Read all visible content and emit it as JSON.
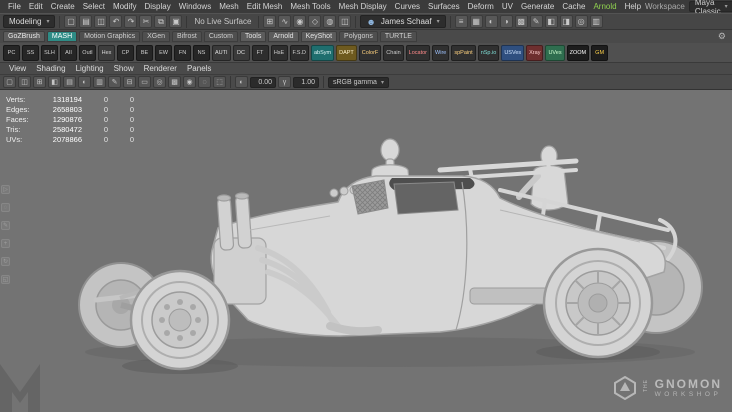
{
  "menubar": {
    "items": [
      {
        "label": "File",
        "color": "#d6d6d6"
      },
      {
        "label": "Edit",
        "color": "#d6d6d6"
      },
      {
        "label": "Create",
        "color": "#d6d6d6"
      },
      {
        "label": "Select",
        "color": "#d6d6d6"
      },
      {
        "label": "Modify",
        "color": "#d6d6d6"
      },
      {
        "label": "Display",
        "color": "#d6d6d6"
      },
      {
        "label": "Windows",
        "color": "#d6d6d6"
      },
      {
        "label": "Mesh",
        "color": "#d6d6d6"
      },
      {
        "label": "Edit Mesh",
        "color": "#d6d6d6"
      },
      {
        "label": "Mesh Tools",
        "color": "#d6d6d6"
      },
      {
        "label": "Mesh Display",
        "color": "#d6d6d6"
      },
      {
        "label": "Curves",
        "color": "#d6d6d6"
      },
      {
        "label": "Surfaces",
        "color": "#d6d6d6"
      },
      {
        "label": "Deform",
        "color": "#d6d6d6"
      },
      {
        "label": "UV",
        "color": "#d6d6d6"
      },
      {
        "label": "Generate",
        "color": "#d6d6d6"
      },
      {
        "label": "Cache",
        "color": "#d6d6d6"
      },
      {
        "label": "Arnold",
        "color": "#8fd14f"
      },
      {
        "label": "Help",
        "color": "#d6d6d6"
      }
    ],
    "workspace_label": "Workspace",
    "workspace_value": "Maya Classic"
  },
  "statusbar": {
    "mode": "Modeling",
    "live_surface": "No Live Surface",
    "user": "James Schaaf",
    "left_icons": [
      {
        "name": "new-scene-icon",
        "glyph": "▢"
      },
      {
        "name": "open-scene-icon",
        "glyph": "▤"
      },
      {
        "name": "save-scene-icon",
        "glyph": "◫"
      },
      {
        "name": "undo-icon",
        "glyph": "↶"
      },
      {
        "name": "redo-icon",
        "glyph": "↷"
      },
      {
        "name": "cut-icon",
        "glyph": "✂"
      },
      {
        "name": "copy-icon",
        "glyph": "⧉"
      },
      {
        "name": "paste-icon",
        "glyph": "▣"
      }
    ],
    "snap_icons": [
      {
        "name": "snap-grid-icon",
        "glyph": "⊞"
      },
      {
        "name": "snap-curve-icon",
        "glyph": "∿"
      },
      {
        "name": "snap-point-icon",
        "glyph": "◉"
      },
      {
        "name": "snap-plane-icon",
        "glyph": "◇"
      },
      {
        "name": "make-live-icon",
        "glyph": "◍"
      },
      {
        "name": "symmetry-icon",
        "glyph": "◫"
      }
    ],
    "right_icons": [
      {
        "name": "history-icon",
        "glyph": "≡"
      },
      {
        "name": "construction-icon",
        "glyph": "▦"
      },
      {
        "name": "render-icon",
        "glyph": "◐"
      },
      {
        "name": "ipr-render-icon",
        "glyph": "◑"
      },
      {
        "name": "render-settings-icon",
        "glyph": "▩"
      },
      {
        "name": "paint-effects-icon",
        "glyph": "✎"
      },
      {
        "name": "hypershade-icon",
        "glyph": "◧"
      },
      {
        "name": "toon-icon",
        "glyph": "◨"
      },
      {
        "name": "light-editor-icon",
        "glyph": "◎"
      },
      {
        "name": "displays-icon",
        "glyph": "▥"
      }
    ]
  },
  "shelf": {
    "tabs": [
      {
        "label": "GoZBrush",
        "bg": "#5c5c5c",
        "fg": "#e8e8e8"
      },
      {
        "label": "MASH",
        "bg": "#2e8c86",
        "fg": "#ffffff"
      },
      {
        "label": "Motion Graphics",
        "bg": "#4f4f4f",
        "fg": "#cfcfcf"
      },
      {
        "label": "XGen",
        "bg": "#4f4f4f",
        "fg": "#cfcfcf"
      },
      {
        "label": "Bifrost",
        "bg": "#4f4f4f",
        "fg": "#cfcfcf"
      },
      {
        "label": "Custom",
        "bg": "#4f4f4f",
        "fg": "#cfcfcf"
      },
      {
        "label": "Tools",
        "bg": "#5c5c5c",
        "fg": "#e2e2e2"
      },
      {
        "label": "Arnold",
        "bg": "#5c5c5c",
        "fg": "#e2e2e2"
      },
      {
        "label": "KeyShot",
        "bg": "#5c5c5c",
        "fg": "#e2e2e2"
      },
      {
        "label": "Polygons",
        "bg": "#4f4f4f",
        "fg": "#cfcfcf"
      },
      {
        "label": "TURTLE",
        "bg": "#4f4f4f",
        "fg": "#cfcfcf"
      }
    ],
    "items": [
      {
        "label": "PC",
        "bg": "#262626",
        "fg": "#cfcfcf"
      },
      {
        "label": "SS",
        "bg": "#262626",
        "fg": "#cfcfcf"
      },
      {
        "label": "SLH",
        "bg": "#262626",
        "fg": "#cfcfcf"
      },
      {
        "label": "AII",
        "bg": "#262626",
        "fg": "#cfcfcf"
      },
      {
        "label": "OutI",
        "bg": "#262626",
        "fg": "#cfcfcf"
      },
      {
        "label": "Hex",
        "bg": "#3d3d3d",
        "fg": "#d8d8d8"
      },
      {
        "label": "CP",
        "bg": "#262626",
        "fg": "#cfcfcf"
      },
      {
        "label": "BE",
        "bg": "#262626",
        "fg": "#cfcfcf"
      },
      {
        "label": "EW",
        "bg": "#262626",
        "fg": "#cfcfcf"
      },
      {
        "label": "FN",
        "bg": "#262626",
        "fg": "#cfcfcf"
      },
      {
        "label": "NS",
        "bg": "#262626",
        "fg": "#cfcfcf"
      },
      {
        "label": "AUTI",
        "bg": "#3a3a3a",
        "fg": "#e0e0e0"
      },
      {
        "label": "DC",
        "bg": "#3a3a3a",
        "fg": "#e0e0e0"
      },
      {
        "label": "FT",
        "bg": "#2e2e2e",
        "fg": "#cfcfcf"
      },
      {
        "label": "HsE",
        "bg": "#2e2e2e",
        "fg": "#cfcfcf"
      },
      {
        "label": "F.S.D",
        "bg": "#2e2e2e",
        "fg": "#cfcfcf"
      },
      {
        "label": "abSym",
        "bg": "#1f6e6e",
        "fg": "#dff5f5"
      },
      {
        "label": "DAPT",
        "bg": "#6e5a1f",
        "fg": "#fff3cf"
      },
      {
        "label": "ColorF",
        "bg": "#303030",
        "fg": "#ffd27f"
      },
      {
        "label": "Chain",
        "bg": "#303030",
        "fg": "#cfcfcf"
      },
      {
        "label": "Locator",
        "bg": "#303030",
        "fg": "#ff8a8a"
      },
      {
        "label": "Wire",
        "bg": "#303030",
        "fg": "#9fc3ff"
      },
      {
        "label": "spPaint",
        "bg": "#303030",
        "fg": "#ffd27f"
      },
      {
        "label": "nSp.io",
        "bg": "#303030",
        "fg": "#7fe0d8"
      },
      {
        "label": "USVes",
        "bg": "#2f4f7f",
        "fg": "#cfe4ff"
      },
      {
        "label": "Xray",
        "bg": "#6e2f2f",
        "fg": "#ffd0d0"
      },
      {
        "label": "UVes",
        "bg": "#2f6e4f",
        "fg": "#d0ffd0"
      },
      {
        "label": "ZOOM",
        "bg": "#1d1d1d",
        "fg": "#ffffff"
      },
      {
        "label": "GM",
        "bg": "#1d1d1d",
        "fg": "#ffd24a"
      }
    ]
  },
  "panel": {
    "menus": [
      "View",
      "Shading",
      "Lighting",
      "Show",
      "Renderer",
      "Panels"
    ],
    "toolbar_icons": [
      {
        "name": "select-camera-icon",
        "glyph": "▢"
      },
      {
        "name": "lock-camera-icon",
        "glyph": "◫"
      },
      {
        "name": "camera-attrs-icon",
        "glyph": "⊞"
      },
      {
        "name": "bookmark-icon",
        "glyph": "◧"
      },
      {
        "name": "image-plane-icon",
        "glyph": "▤"
      },
      {
        "name": "2d-pan-zoom-icon",
        "glyph": "◐"
      },
      {
        "name": "oversc-icon",
        "glyph": "▥"
      },
      {
        "name": "grease-pencil-icon",
        "glyph": "✎"
      },
      {
        "name": "grid-icon",
        "glyph": "⊟"
      },
      {
        "name": "film-gate-icon",
        "glyph": "▭"
      },
      {
        "name": "res-gate-icon",
        "glyph": "◎"
      },
      {
        "name": "gate-mask-icon",
        "glyph": "▩"
      },
      {
        "name": "field-chart-icon",
        "glyph": "◉"
      },
      {
        "name": "safe-action-icon",
        "glyph": "◌"
      },
      {
        "name": "safe-title-icon",
        "glyph": "⬚"
      }
    ],
    "exposure": "0.00",
    "gamma": "1.00",
    "view_transform": "sRGB gamma"
  },
  "hud": {
    "rows": [
      {
        "label": "Verts:",
        "total": "1318194",
        "c2": "0",
        "c3": "0"
      },
      {
        "label": "Edges:",
        "total": "2658803",
        "c2": "0",
        "c3": "0"
      },
      {
        "label": "Faces:",
        "total": "1290876",
        "c2": "0",
        "c3": "0"
      },
      {
        "label": "Tris:",
        "total": "2580472",
        "c2": "0",
        "c3": "0"
      },
      {
        "label": "UVs:",
        "total": "2078866",
        "c2": "0",
        "c3": "0"
      }
    ]
  },
  "toolbox": [
    {
      "name": "select-tool-icon",
      "glyph": "▷"
    },
    {
      "name": "lasso-tool-icon",
      "glyph": "◌"
    },
    {
      "name": "paint-select-tool-icon",
      "glyph": "✎"
    },
    {
      "name": "move-tool-icon",
      "glyph": "+"
    },
    {
      "name": "rotate-tool-icon",
      "glyph": "↻"
    },
    {
      "name": "scale-tool-icon",
      "glyph": "◱"
    }
  ],
  "watermark": {
    "the": "THE",
    "name": "GNOMON",
    "sub": "WORKSHOP"
  },
  "colors": {
    "viewport_bg": "#737373",
    "clay": "#d6d6d6",
    "accent_teal": "#2e8c86",
    "arnold_green": "#8fd14f"
  }
}
